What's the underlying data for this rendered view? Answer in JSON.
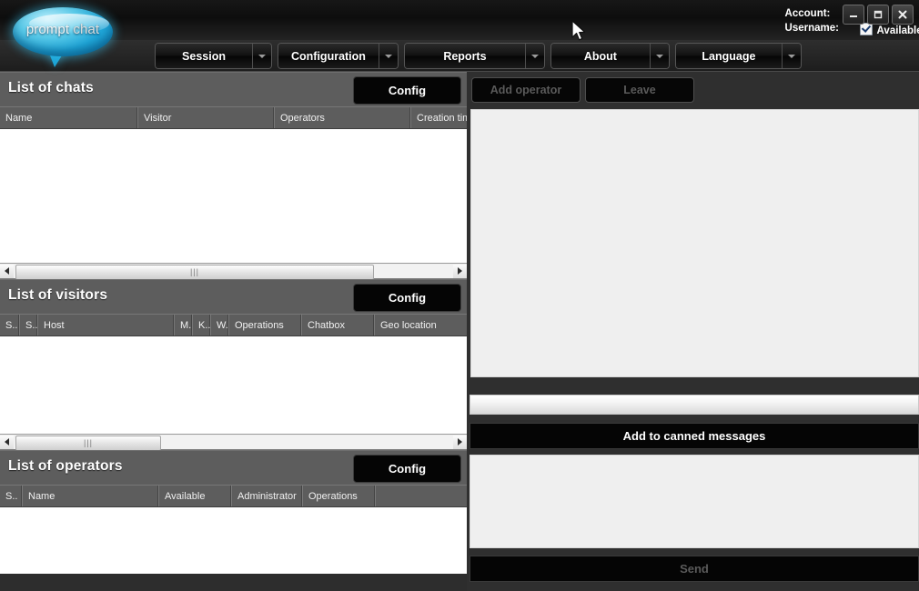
{
  "app": {
    "logo_word1": "prompt",
    "logo_word2": " chat",
    "accent_logo": "#2fb6e0",
    "header_bg": "#0d0d0d",
    "panel_bg": "#5d5d5d"
  },
  "titlebar": {
    "account_label": "Account:",
    "account_value": "",
    "username_label": "Username:",
    "username_value": "",
    "available_label": "Available for chat",
    "available_checked": true,
    "window_buttons": [
      {
        "name": "minimize-button",
        "glyph": "_"
      },
      {
        "name": "maximize-button",
        "glyph": "□"
      },
      {
        "name": "close-button",
        "glyph": "✕"
      }
    ]
  },
  "menubar": {
    "items": [
      {
        "label": "Session"
      },
      {
        "label": "Configuration"
      },
      {
        "label": "Reports"
      },
      {
        "label": "About"
      },
      {
        "label": "Language"
      }
    ]
  },
  "chats_panel": {
    "title": "List of chats",
    "config_label": "Config",
    "columns": [
      "Name",
      "Visitor",
      "Operators",
      "Creation tim"
    ],
    "rows": []
  },
  "visitors_panel": {
    "title": "List of visitors",
    "config_label": "Config",
    "columns": [
      "S..",
      "S..",
      "Host",
      "M..",
      "K..",
      "W..",
      "Operations",
      "Chatbox",
      "Geo location"
    ],
    "rows": []
  },
  "operators_panel": {
    "title": "List of operators",
    "config_label": "Config",
    "columns": [
      "S..",
      "Name",
      "Available",
      "Administrator",
      "Operations",
      ""
    ],
    "rows": []
  },
  "chat_panel": {
    "add_operator_label": "Add operator",
    "add_operator_enabled": false,
    "leave_label": "Leave",
    "leave_enabled": false,
    "transcript": "",
    "quick_input_value": "",
    "canned_label": "Add to canned messages",
    "canned_enabled": true,
    "message_value": "",
    "send_label": "Send",
    "send_enabled": false
  }
}
